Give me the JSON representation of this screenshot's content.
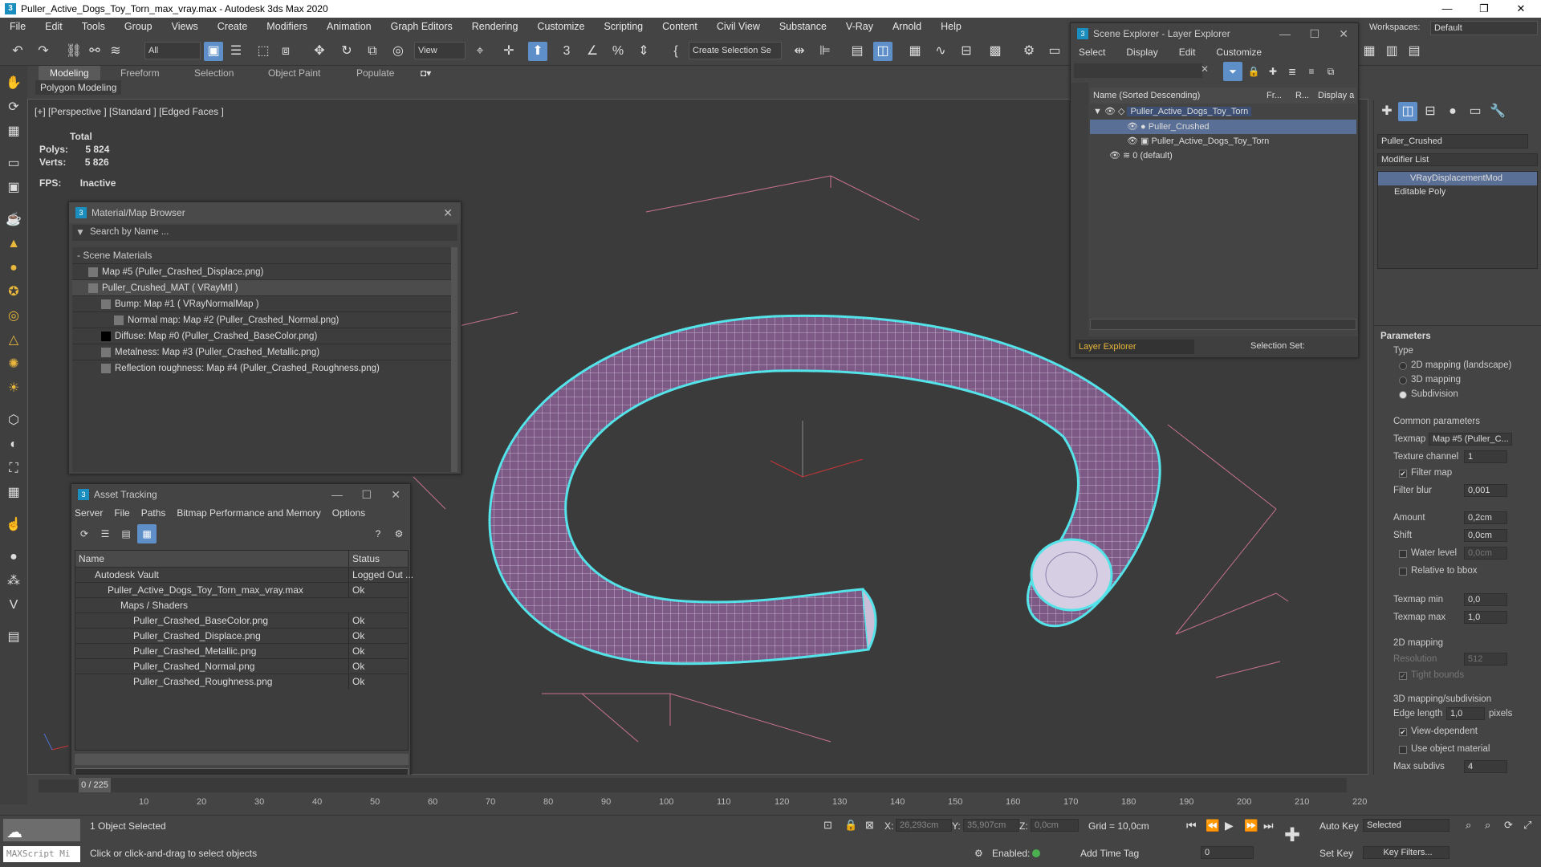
{
  "window": {
    "title": "Puller_Active_Dogs_Toy_Torn_max_vray.max - Autodesk 3ds Max 2020",
    "workspace_label": "Workspaces:",
    "workspace_value": "Default"
  },
  "menu": [
    "File",
    "Edit",
    "Tools",
    "Group",
    "Views",
    "Create",
    "Modifiers",
    "Animation",
    "Graph Editors",
    "Rendering",
    "Customize",
    "Scripting",
    "Content",
    "Civil View",
    "Substance",
    "V-Ray",
    "Arnold",
    "Help"
  ],
  "toolbar": {
    "filter": "All",
    "view": "View",
    "selection_set": "Create Selection Se"
  },
  "ribbon": {
    "tabs": [
      "Modeling",
      "Freeform",
      "Selection",
      "Object Paint",
      "Populate"
    ],
    "sub": "Polygon Modeling"
  },
  "viewport": {
    "label": "[+] [Perspective ] [Standard ] [Edged Faces ]",
    "total_label": "Total",
    "polys_label": "Polys:",
    "polys": "5 824",
    "verts_label": "Verts:",
    "verts": "5 826",
    "fps_label": "FPS:",
    "fps": "Inactive"
  },
  "material_browser": {
    "title": "Material/Map Browser",
    "search_placeholder": "Search by Name ...",
    "group": "Scene Materials",
    "items": [
      "Map #5 (Puller_Crashed_Displace.png)",
      "Puller_Crushed_MAT  ( VRayMtl )",
      "Bump: Map #1  ( VRayNormalMap )",
      "Normal map: Map #2 (Puller_Crashed_Normal.png)",
      "Diffuse: Map #0 (Puller_Crashed_BaseColor.png)",
      "Metalness: Map #3 (Puller_Crashed_Metallic.png)",
      "Reflection roughness: Map #4 (Puller_Crashed_Roughness.png)"
    ]
  },
  "asset_tracking": {
    "title": "Asset Tracking",
    "menu": [
      "Server",
      "File",
      "Paths",
      "Bitmap Performance and Memory",
      "Options"
    ],
    "col_name": "Name",
    "col_status": "Status",
    "rows": [
      {
        "name": "Autodesk Vault",
        "status": "Logged Out ..."
      },
      {
        "name": "Puller_Active_Dogs_Toy_Torn_max_vray.max",
        "status": "Ok"
      },
      {
        "name": "Maps / Shaders",
        "status": ""
      },
      {
        "name": "Puller_Crashed_BaseColor.png",
        "status": "Ok"
      },
      {
        "name": "Puller_Crashed_Displace.png",
        "status": "Ok"
      },
      {
        "name": "Puller_Crashed_Metallic.png",
        "status": "Ok"
      },
      {
        "name": "Puller_Crashed_Normal.png",
        "status": "Ok"
      },
      {
        "name": "Puller_Crashed_Roughness.png",
        "status": "Ok"
      }
    ]
  },
  "scene_explorer": {
    "title": "Scene Explorer - Layer Explorer",
    "menu": [
      "Select",
      "Display",
      "Edit",
      "Customize"
    ],
    "col_name": "Name (Sorted Descending)",
    "col_fr": "Fr...",
    "col_r": "R...",
    "col_display": "Display a",
    "rows": [
      "Puller_Active_Dogs_Toy_Torn",
      "Puller_Crushed",
      "Puller_Active_Dogs_Toy_Torn",
      "0 (default)"
    ],
    "footer_explorer": "Layer Explorer",
    "footer_selset": "Selection Set:"
  },
  "command_panel": {
    "object_name": "Puller_Crushed",
    "modifier_list": "Modifier List",
    "stack": [
      "VRayDisplacementMod",
      "Editable Poly"
    ],
    "params_title": "Parameters",
    "type_label": "Type",
    "type_options": [
      "2D mapping (landscape)",
      "3D mapping",
      "Subdivision"
    ],
    "common_label": "Common parameters",
    "texmap_label": "Texmap",
    "texmap_value": "Map #5 (Puller_C...",
    "texchan_label": "Texture channel",
    "texchan_value": "1",
    "filtermap_label": "Filter map",
    "filterblur_label": "Filter blur",
    "filterblur_value": "0,001",
    "amount_label": "Amount",
    "amount_value": "0,2cm",
    "shift_label": "Shift",
    "shift_value": "0,0cm",
    "waterlevel_label": "Water level",
    "waterlevel_value": "0,0cm",
    "relbbox_label": "Relative to bbox",
    "texmin_label": "Texmap min",
    "texmin_value": "0,0",
    "texmax_label": "Texmap max",
    "texmax_value": "1,0",
    "map2d_label": "2D mapping",
    "resolution_label": "Resolution",
    "resolution_value": "512",
    "tight_label": "Tight bounds",
    "map3d_label": "3D mapping/subdivision",
    "edge_label": "Edge length",
    "edge_value": "1,0",
    "edge_unit": "pixels",
    "viewdep_label": "View-dependent",
    "useobj_label": "Use object material",
    "maxsub_label": "Max subdivs",
    "maxsub_value": "4"
  },
  "timeline": {
    "frame": "0 / 225",
    "ticks": [
      "10",
      "20",
      "30",
      "40",
      "50",
      "60",
      "70",
      "80",
      "90",
      "100",
      "110",
      "120",
      "130",
      "140",
      "150",
      "160",
      "170",
      "180",
      "190",
      "200",
      "210",
      "220"
    ]
  },
  "status": {
    "selected": "1 Object Selected",
    "hint": "Click or click-and-drag to select objects",
    "x_label": "X:",
    "x": "26,293cm",
    "y_label": "Y:",
    "y": "35,907cm",
    "z_label": "Z:",
    "z": "0,0cm",
    "grid": "Grid = 10,0cm",
    "enabled": "Enabled:",
    "add_time_tag": "Add Time Tag",
    "autokey": "Auto Key",
    "setkey": "Set Key",
    "selected_dd": "Selected",
    "key_filters": "Key Filters...",
    "frame_value": "0",
    "maxscript": "MAXScript Mi"
  }
}
